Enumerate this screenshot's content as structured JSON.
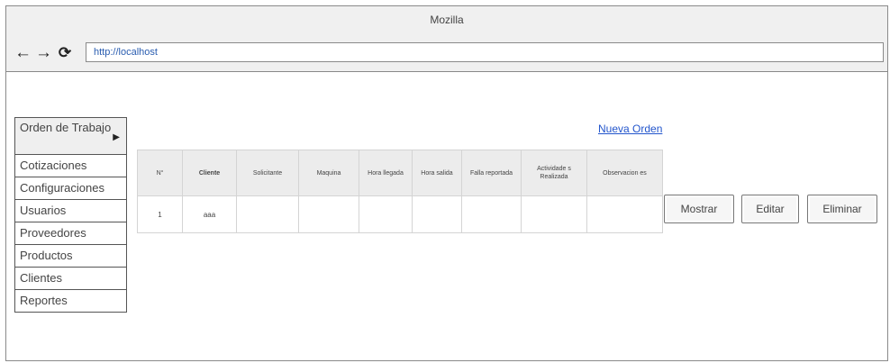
{
  "window": {
    "title": "Mozilla"
  },
  "nav": {
    "back_icon": "←",
    "forward_icon": "→",
    "reload_icon": "⟳",
    "url": "http://localhost"
  },
  "sidebar": {
    "items": [
      {
        "label": "Orden de Trabajo",
        "has_arrow": true,
        "arrow_icon": "▶"
      },
      {
        "label": "Cotizaciones"
      },
      {
        "label": "Configuraciones"
      },
      {
        "label": "Usuarios"
      },
      {
        "label": "Proveedores"
      },
      {
        "label": "Productos"
      },
      {
        "label": "Clientes"
      },
      {
        "label": "Reportes"
      }
    ]
  },
  "main": {
    "new_order_link": "Nueva Orden",
    "table": {
      "headers": [
        "N°",
        "Cliente",
        "Solicitante",
        "Maquina",
        "Hora llegada",
        "Hora salida",
        "Falla reportada",
        "Actividade s Realizada",
        "Observacion es"
      ],
      "rows": [
        [
          "1",
          "aaa",
          "",
          "",
          "",
          "",
          "",
          "",
          ""
        ]
      ]
    },
    "buttons": {
      "mostrar": "Mostrar",
      "editar": "Editar",
      "eliminar": "Eliminar"
    }
  }
}
